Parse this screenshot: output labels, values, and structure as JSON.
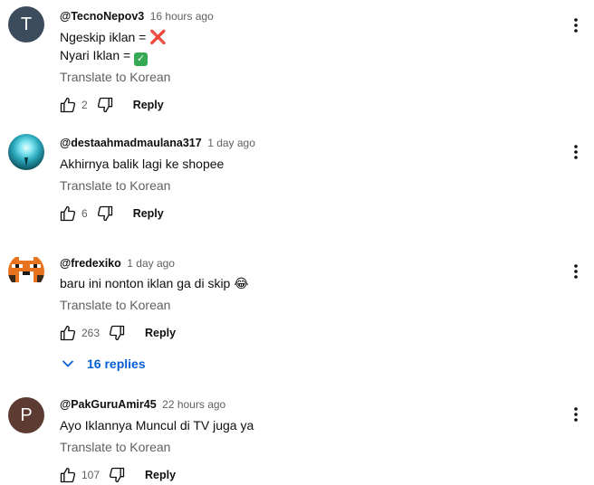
{
  "comments": [
    {
      "author": "@TecnoNepov3",
      "time": "16 hours ago",
      "avatar_letter": "T",
      "avatar_color": "#3d4c5c",
      "line1": "Ngeskip iklan = ",
      "line1_emoji": "❌",
      "line2": "Nyari Iklan = ",
      "line2_emoji": "✅",
      "translate": "Translate to Korean",
      "likes": "2",
      "reply": "Reply"
    },
    {
      "author": "@destaahmadmaulana317",
      "time": "1 day ago",
      "avatar_color": "#0c4a55",
      "line1": "Akhirnya balik lagi ke shopee",
      "translate": "Translate to Korean",
      "likes": "6",
      "reply": "Reply"
    },
    {
      "author": "@fredexiko",
      "time": "1 day ago",
      "avatar_color": "#e56a1c",
      "line1": "baru ini nonton iklan ga di skip ",
      "line1_emoji": "😂",
      "translate": "Translate to Korean",
      "likes": "263",
      "reply": "Reply",
      "replies_label": "16 replies"
    },
    {
      "author": "@PakGuruAmir45",
      "time": "22 hours ago",
      "avatar_letter": "P",
      "avatar_color": "#5d3a32",
      "line1": "Ayo Iklannya Muncul di TV juga ya",
      "translate": "Translate to Korean",
      "likes": "107",
      "reply": "Reply"
    }
  ]
}
